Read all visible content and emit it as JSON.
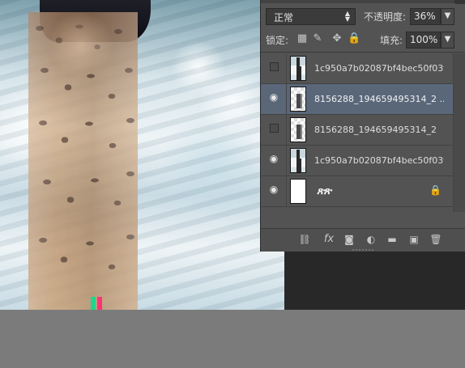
{
  "layers_panel": {
    "blend_mode": "正常",
    "opacity_label": "不透明度:",
    "opacity_value": "36%",
    "lock_label": "锁定:",
    "fill_label": "填充:",
    "fill_value": "100%",
    "layers": [
      {
        "name": "1c950a7b02087bf4bec50f03f...",
        "visible": false,
        "selected": false,
        "thumbnail": "photo"
      },
      {
        "name": "8156288_194659495314_2 ...",
        "visible": true,
        "selected": true,
        "thumbnail": "checker-figure"
      },
      {
        "name": "8156288_194659495314_2",
        "visible": false,
        "selected": false,
        "thumbnail": "checker-figure"
      },
      {
        "name": "1c950a7b02087bf4bec50f03f...",
        "visible": true,
        "selected": false,
        "thumbnail": "photo"
      },
      {
        "name": "",
        "visible": true,
        "selected": false,
        "thumbnail": "white",
        "locked": true
      }
    ],
    "footer_icons": [
      "link-icon",
      "fx-icon",
      "mask-icon",
      "adjustment-icon",
      "folder-icon",
      "new-layer-icon",
      "trash-icon"
    ]
  },
  "colors": {
    "panel_bg": "#535353",
    "selected_row": "#596779",
    "dark_workspace": "#282828",
    "bottom_gray": "#7b7b7b"
  }
}
